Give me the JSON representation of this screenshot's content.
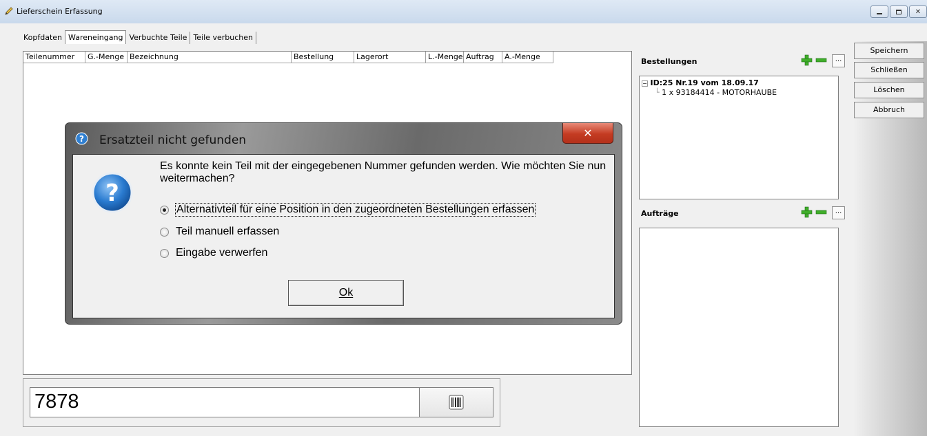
{
  "window": {
    "title": "Lieferschein Erfassung"
  },
  "tabs": [
    "Kopfdaten",
    "Wareneingang",
    "Verbuchte Teile",
    "Teile verbuchen"
  ],
  "active_tab": "Wareneingang",
  "grid": {
    "columns": [
      "Teilenummer",
      "G.-Menge",
      "Bezeichnung",
      "Bestellung",
      "Lagerort",
      "L.-Menge",
      "Auftrag",
      "A.-Menge"
    ]
  },
  "input": {
    "value": "7878"
  },
  "bestellungen": {
    "title": "Bestellungen",
    "more_label": "...",
    "tree_root": "ID:25 Nr.19 vom 18.09.17",
    "tree_child": "1 x 93184414 - MOTORHAUBE"
  },
  "auftraege": {
    "title": "Aufträge",
    "more_label": "..."
  },
  "side_buttons": {
    "save": "Speichern",
    "close": "Schließen",
    "delete": "Löschen",
    "cancel": "Abbruch"
  },
  "dialog": {
    "title": "Ersatzteil nicht gefunden",
    "message": "Es konnte kein Teil mit der eingegebenen Nummer gefunden werden. Wie möchten Sie nun weitermachen?",
    "options": [
      "Alternativteil für eine Position in den zugeordneten Bestellungen erfassen",
      "Teil manuell erfassen",
      "Eingabe verwerfen"
    ],
    "selected_option": 0,
    "ok_label": "Ok"
  },
  "colors": {
    "add_green": "#3fae2a",
    "remove_green": "#3fae2a",
    "close_red": "#c43b22",
    "help_blue": "#2f7fd1"
  },
  "icons": {
    "title": "pencil-icon",
    "barcode": "barcode-icon",
    "help": "question-icon",
    "close": "close-icon",
    "add": "plus-icon",
    "remove": "minus-icon"
  }
}
